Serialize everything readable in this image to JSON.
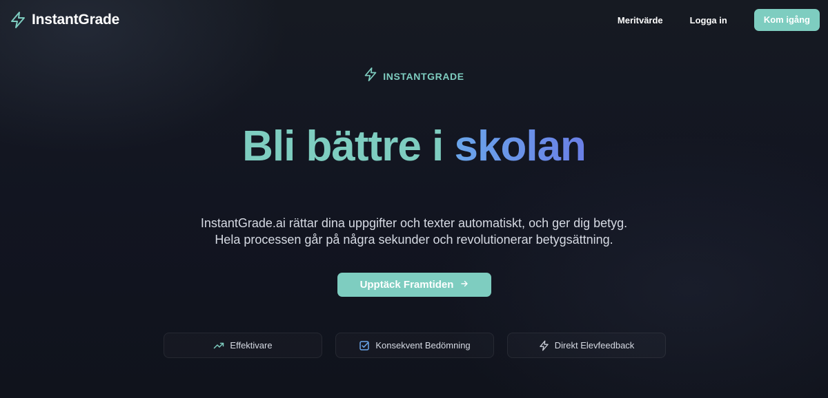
{
  "nav": {
    "brand": "InstantGrade",
    "links": [
      "Meritvärde",
      "Logga in"
    ],
    "cta": "Kom igång"
  },
  "hero": {
    "eyebrow": "INSTANTGRADE",
    "headline_part1": "Bli bättre i ",
    "headline_part2": "skolan",
    "description_line1": "InstantGrade.ai rättar dina uppgifter och texter automatiskt, och ger dig betyg.",
    "description_line2": "Hela processen går på några sekunder och revolutionerar betygsättning.",
    "cta": "Upptäck Framtiden",
    "cta_icon": "arrow-right-icon"
  },
  "features": [
    {
      "label": "Effektivare",
      "icon": "trending-up-icon"
    },
    {
      "label": "Konsekvent Bedömning",
      "icon": "checkbox-icon"
    },
    {
      "label": "Direkt Elevfeedback",
      "icon": "lightning-icon"
    }
  ],
  "colors": {
    "accent": "#7ecdc0",
    "gradient_start": "#6aa6ea",
    "gradient_end": "#6a7fe6",
    "background": "#11141d"
  }
}
